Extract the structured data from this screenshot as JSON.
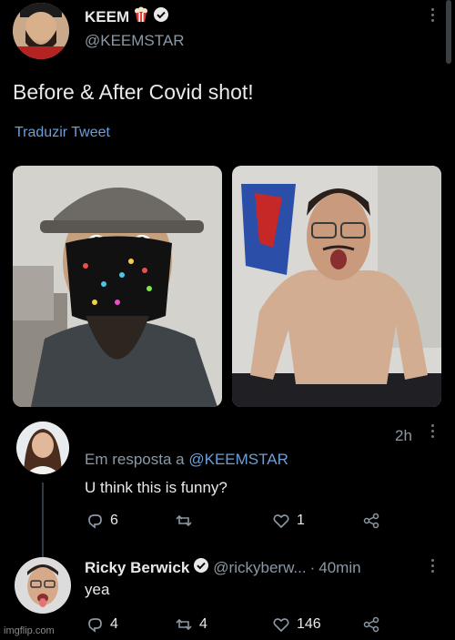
{
  "tweet": {
    "author_name": "KEEM",
    "author_handle": "@KEEMSTAR",
    "text": "Before & After Covid shot!",
    "translate_label": "Traduzir Tweet"
  },
  "reply1": {
    "time": "2h",
    "replying_prefix": "Em resposta a",
    "replying_mention": "@KEEMSTAR",
    "text": "U think this is funny?",
    "reply_count": "6",
    "retweet_count": "",
    "like_count": "1"
  },
  "reply2": {
    "author_name": "Ricky Berwick",
    "author_handle": "@rickyberw...",
    "separator": "·",
    "time": "40min",
    "text": "yea",
    "reply_count": "4",
    "retweet_count": "4",
    "like_count": "146"
  },
  "watermark": "imgflip.com",
  "colors": {
    "background": "#000000",
    "link": "#6a9fd8",
    "muted": "#8b98a5",
    "verified": "#e7e9ea"
  }
}
